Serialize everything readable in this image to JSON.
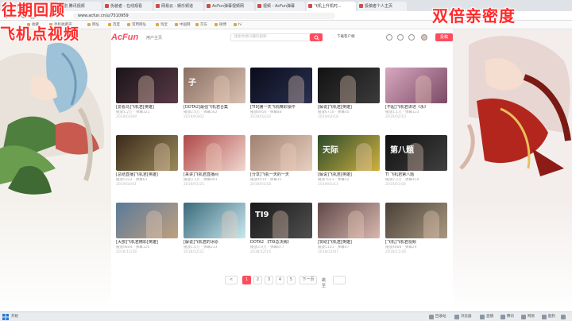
{
  "browser": {
    "tabs": [
      {
        "label": "Baidu 网站 — 中文",
        "active": false
      },
      {
        "label": "番剧 腾讯视频",
        "active": false
      },
      {
        "label": "伪装者 - 在线观看",
        "active": false
      },
      {
        "label": "网易云 - 娱乐频道",
        "active": false
      },
      {
        "label": "AcFun弹幕视频网",
        "active": false
      },
      {
        "label": "视频 - AcFun弹幕",
        "active": false
      },
      {
        "label": "飞机上升机时...",
        "active": true
      },
      {
        "label": "投稿者个人主页",
        "active": false
      }
    ],
    "address": "www.acfun.cn/u/7510959",
    "bookmarks": [
      "收藏",
      "手机收藏夹",
      "网址",
      "百度",
      "常用网址",
      "淘宝",
      "中国网",
      "京东",
      "微博",
      "hi"
    ]
  },
  "overlays": {
    "top_left_1": "往期回顾",
    "top_left_2": "飞机点视频",
    "top_right": "双倍亲密度"
  },
  "header": {
    "logo": "AcFun",
    "logo_sub": "用户主页",
    "search_placeholder": "搜索你感兴趣的视频",
    "search_icon": "search-icon",
    "download_app": "下载客户端",
    "post_label": "投稿"
  },
  "videos": [
    {
      "thumb_text": "",
      "title": "[爱看马]飞机君[英雄]",
      "meta": "播放1.2万 · 弹幕321",
      "date": "2019/03/09",
      "color_a": "#1a1418",
      "color_b": "#5a3a48"
    },
    {
      "thumb_text": "子",
      "title": "[DOTA2]最强飞机君合集",
      "meta": "播放2.4万 · 弹幕502",
      "date": "2019/03/02",
      "color_a": "#8a6f62",
      "color_b": "#d9c0b0"
    },
    {
      "thumb_text": "",
      "title": "[TI9]第一天飞机精彩操作",
      "meta": "播放8956 · 弹幕88",
      "date": "2019/02/24",
      "color_a": "#0a0c1a",
      "color_b": "#2a3050"
    },
    {
      "thumb_text": "",
      "title": "[解说]飞机君[英雄]",
      "meta": "播放6710 · 弹幕40",
      "date": "2019/02/18",
      "color_a": "#121212",
      "color_b": "#3b3b3b"
    },
    {
      "thumb_text": "",
      "title": "[不起]飞机君讲述《永》",
      "meta": "播放1.1万 · 弹幕113",
      "date": "2019/02/10",
      "color_a": "#d8a8c0",
      "color_b": "#7a4a66"
    },
    {
      "thumb_text": "",
      "title": "[总结直播]飞机君[英雄]",
      "meta": "播放5322 · 弹幕61",
      "date": "2019/02/01",
      "color_a": "#3a2a1a",
      "color_b": "#9a8a5a"
    },
    {
      "thumb_text": "",
      "title": "[来讲]飞机君直播间",
      "meta": "播放3.3万 · 弹幕903",
      "date": "2019/01/25",
      "color_a": "#b04848",
      "color_b": "#f0d8d0"
    },
    {
      "thumb_text": "",
      "title": "[分享]飞机一天的一天",
      "meta": "播放4410 · 弹幕35",
      "date": "2019/01/18",
      "color_a": "#a08070",
      "color_b": "#e8d0c0"
    },
    {
      "thumb_text": "天际",
      "title": "[解说]飞机君[英雄]",
      "meta": "播放7021 · 弹幕52",
      "date": "2019/01/11",
      "color_a": "#2a4a2a",
      "color_b": "#d0b040"
    },
    {
      "thumb_text": "第八题",
      "title": "TI 飞机君第八题",
      "meta": "播放2.2万 · 弹幕410",
      "date": "2019/01/04",
      "color_a": "#101010",
      "color_b": "#404040"
    },
    {
      "thumb_text": "",
      "title": "[大部]飞机君精彩[英雄]",
      "meta": "播放9804 · 弹幕120",
      "date": "2018/12/28",
      "color_a": "#5a7a9a",
      "color_b": "#c0a080"
    },
    {
      "thumb_text": "",
      "title": "[解说]飞机君的冰原",
      "meta": "播放1.6万 · 弹幕233",
      "date": "2018/12/21",
      "color_a": "#3a6a7a",
      "color_b": "#c8e8f0"
    },
    {
      "thumb_text": "TI9",
      "title": "DOTA2 【TI9总决赛】",
      "meta": "播放3.9万 · 弹幕877",
      "date": "2018/12/14",
      "color_a": "#181818",
      "color_b": "#505050"
    },
    {
      "thumb_text": "",
      "title": "[赞助]飞机君[英雄]",
      "meta": "播放5101 · 弹幕47",
      "date": "2018/12/07",
      "color_a": "#604848",
      "color_b": "#d8b8b0"
    },
    {
      "thumb_text": "",
      "title": "[飞机]飞机君视频",
      "meta": "播放4888 · 弹幕29",
      "date": "2018/11/30",
      "color_a": "#4a4038",
      "color_b": "#a89880"
    }
  ],
  "pagination": {
    "prev": "<",
    "pages": [
      "1",
      "2",
      "3",
      "4",
      "5"
    ],
    "current": "1",
    "next": "下一页",
    "jump_label": "跳至",
    "jump_value": ""
  },
  "taskbar": {
    "start_label": "开始",
    "items": [
      "回收站",
      "浏览器",
      "直播",
      "腾讯",
      "网易",
      "酷狗",
      "其他"
    ]
  },
  "colors": {
    "accent": "#fd4c5d",
    "overlay_red": "#ff2a2a"
  }
}
